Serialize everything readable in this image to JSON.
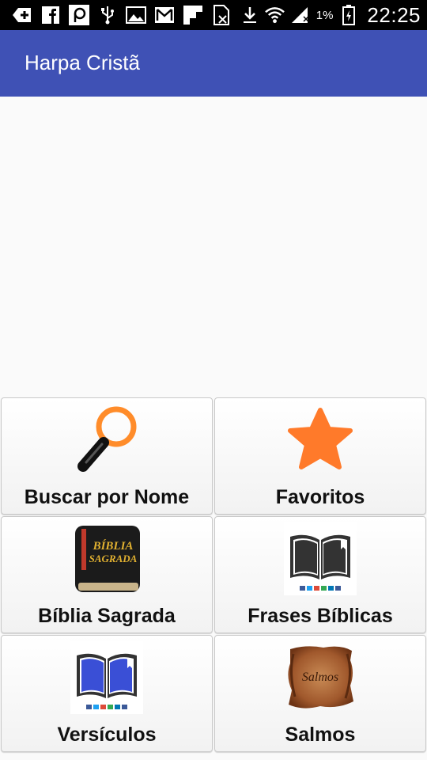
{
  "status_bar": {
    "battery_percent": "1%",
    "time": "22:25",
    "icons": [
      "add-icon",
      "facebook-icon",
      "p-app-icon",
      "usb-icon",
      "gallery-icon",
      "gmail-icon",
      "flipboard-icon",
      "no-sim-icon",
      "download-icon",
      "wifi-icon",
      "signal-icon",
      "battery-icon"
    ]
  },
  "app_bar": {
    "title": "Harpa Cristã"
  },
  "menu": {
    "tiles": [
      {
        "label": "Buscar por Nome",
        "icon": "magnifier-icon"
      },
      {
        "label": "Favoritos",
        "icon": "star-icon"
      },
      {
        "label": "Bíblia Sagrada",
        "icon": "bible-book-icon",
        "icon_text": "Bíblia Sagrada"
      },
      {
        "label": "Frases Bíblicas",
        "icon": "open-book-icon"
      },
      {
        "label": "Versículos",
        "icon": "open-book-blue-icon"
      },
      {
        "label": "Salmos",
        "icon": "parchment-scroll-icon",
        "icon_text": "Salmos"
      }
    ]
  },
  "colors": {
    "app_bar": "#3f51b5",
    "status_bar": "#000000",
    "star": "#ff7a2a",
    "magnifier_ring": "#ff8c2a"
  }
}
